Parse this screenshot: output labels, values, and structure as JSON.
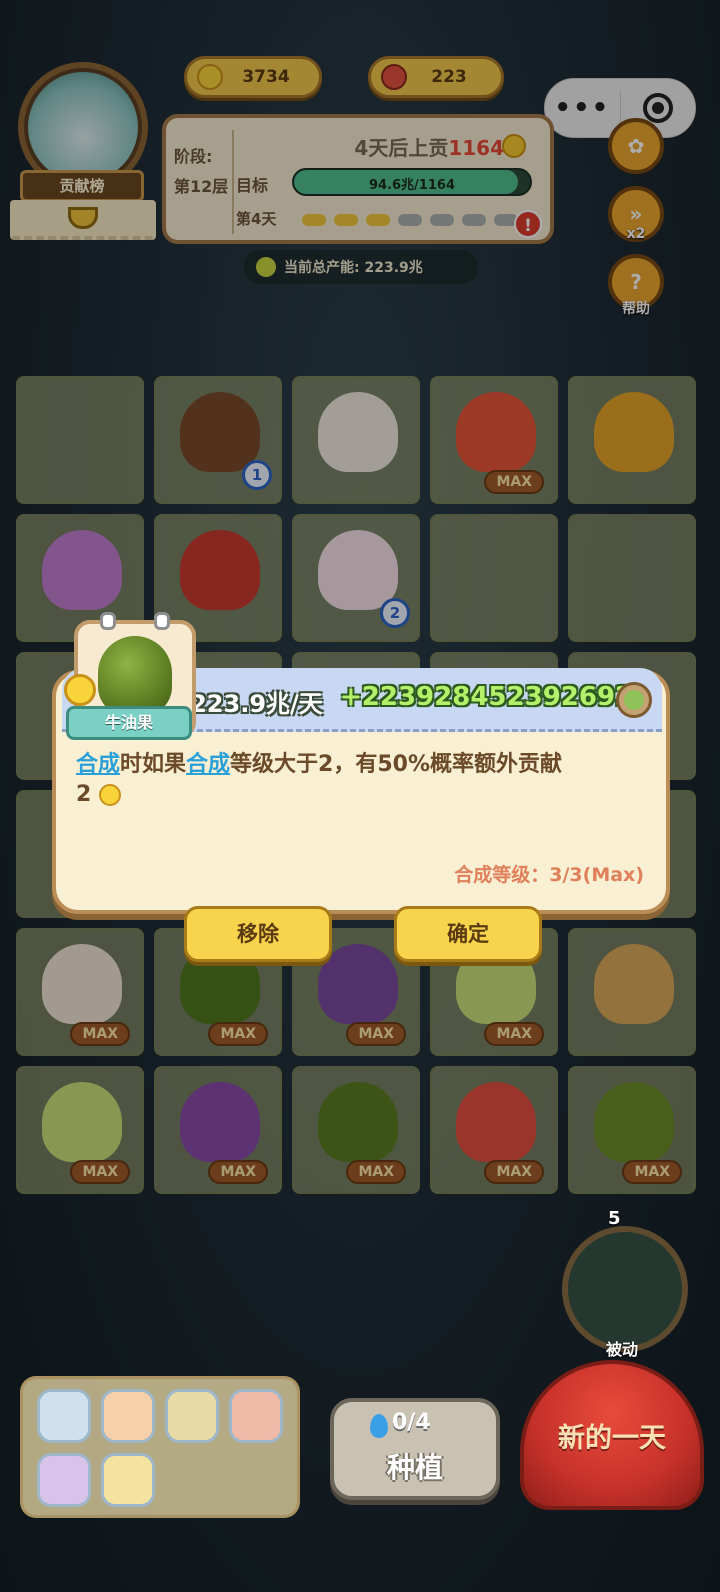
{
  "resources": {
    "sun": {
      "value": "3734",
      "icon": "sun-icon"
    },
    "mushroom": {
      "value": "223",
      "icon": "mushroom-icon"
    }
  },
  "capsule": {
    "more": "•••",
    "icons": [
      "more-icon",
      "record-icon"
    ]
  },
  "rank": {
    "label": "贡献榜"
  },
  "stage": {
    "stage_label": "阶段:",
    "floor": "第12层",
    "title_prefix": "4天后上贡",
    "title_amount": "1164",
    "goal_label": "目标",
    "goal_text": "94.6兆/1164",
    "goal_progress": 0.95,
    "day_label": "第4天",
    "days_total": 7,
    "days_done": 3,
    "warning": "!"
  },
  "capacity": {
    "text": "当前总产能:  223.9兆"
  },
  "side": {
    "speed_caption": "x2",
    "help_caption": "帮助"
  },
  "grid": {
    "rows": 6,
    "cols": 5,
    "cells": [
      {
        "row": 0,
        "col": 0,
        "plant": ""
      },
      {
        "row": 0,
        "col": 1,
        "plant": "brown-mushroom",
        "level": "1",
        "color": "#7a4a2c"
      },
      {
        "row": 0,
        "col": 2,
        "plant": "snail",
        "color": "#f0e8e0"
      },
      {
        "row": 0,
        "col": 3,
        "plant": "red-mushroom",
        "max": "MAX",
        "color": "#e6543a"
      },
      {
        "row": 0,
        "col": 4,
        "plant": "yellow-mushroom",
        "color": "#e3a227"
      },
      {
        "row": 1,
        "col": 0,
        "plant": "pink-creature",
        "color": "#c07ed0"
      },
      {
        "row": 1,
        "col": 1,
        "plant": "spotted-mushroom",
        "color": "#c93a2e"
      },
      {
        "row": 1,
        "col": 2,
        "plant": "butterfly",
        "level": "2",
        "color": "#f7e0e8"
      },
      {
        "row": 1,
        "col": 3,
        "plant": ""
      },
      {
        "row": 1,
        "col": 4,
        "plant": ""
      },
      {
        "row": 4,
        "col": 0,
        "plant": "egg",
        "max": "MAX",
        "color": "#efe4d4"
      },
      {
        "row": 4,
        "col": 1,
        "plant": "avocado",
        "max": "MAX",
        "color": "#4f7a1e"
      },
      {
        "row": 4,
        "col": 2,
        "plant": "eggplant",
        "max": "MAX",
        "color": "#7b4aa0"
      },
      {
        "row": 4,
        "col": 3,
        "plant": "cabbage",
        "max": "MAX",
        "color": "#c9e07a"
      },
      {
        "row": 4,
        "col": 4,
        "plant": "potato",
        "color": "#d9a85a"
      },
      {
        "row": 5,
        "col": 0,
        "plant": "cabbage",
        "max": "MAX",
        "color": "#c9e07a"
      },
      {
        "row": 5,
        "col": 1,
        "plant": "eggplant",
        "max": "MAX",
        "color": "#8a4aa8"
      },
      {
        "row": 5,
        "col": 2,
        "plant": "avocado",
        "max": "MAX",
        "color": "#5a7d22"
      },
      {
        "row": 5,
        "col": 3,
        "plant": "spotted-mushroom",
        "max": "MAX",
        "color": "#e24e3e"
      },
      {
        "row": 5,
        "col": 4,
        "plant": "avocado",
        "max": "MAX",
        "color": "#6a8d2a"
      }
    ]
  },
  "popup": {
    "plant_name": "牛油果",
    "yield": "+223.9兆/天",
    "bonus": "+2239284523926​92",
    "desc_part1": "合成",
    "desc_part2": "时如果",
    "desc_part3": "合成",
    "desc_part4": "等级大于2，有50%概率额外贡献",
    "desc_part5": "2",
    "merge_level": "合成等级：3/3(Max)",
    "remove_label": "移除",
    "confirm_label": "确定"
  },
  "bottom": {
    "passive_count": "5",
    "passive_label": "被动",
    "plant_count": "0/4",
    "plant_label": "种植",
    "newday_label": "新的一天",
    "tools": [
      "scroll-icon",
      "mushroom-icon",
      "map-icon",
      "spotted-mushroom-icon",
      "bee-icon",
      "seed-packet-icon"
    ]
  }
}
